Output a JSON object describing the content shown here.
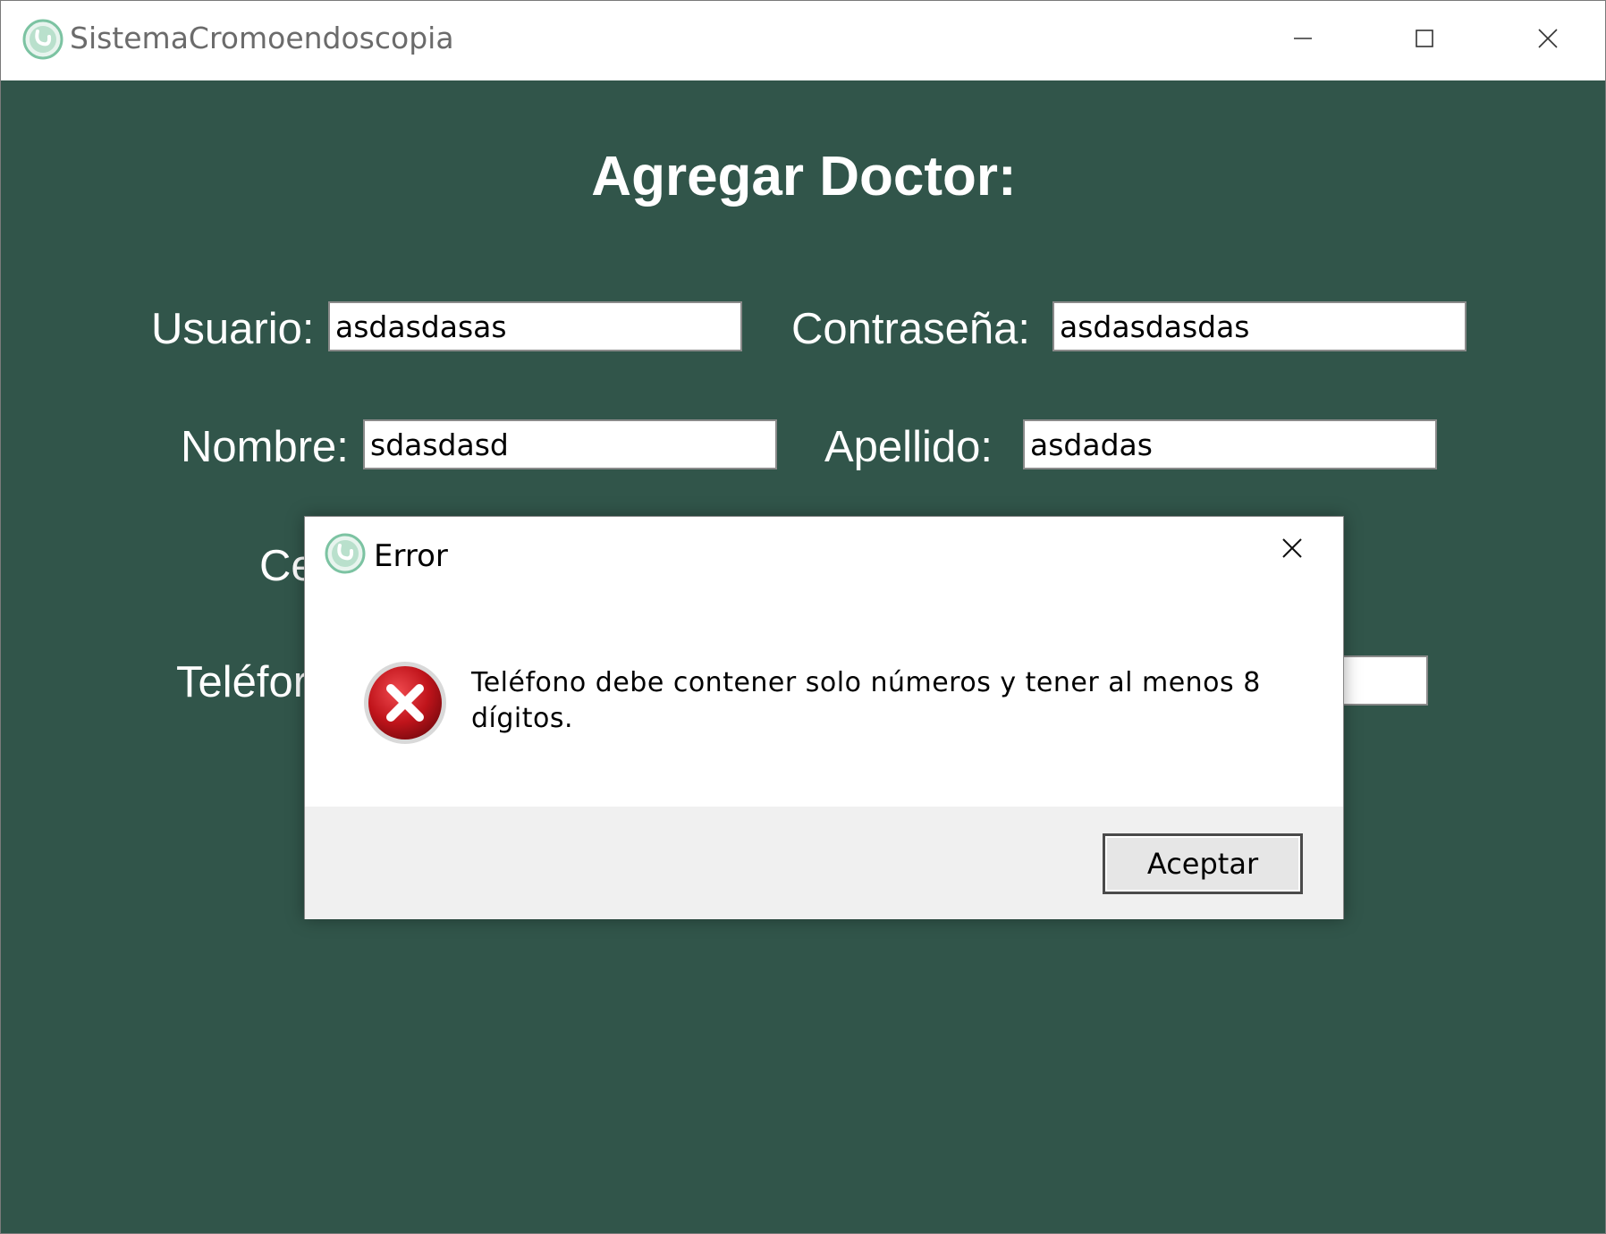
{
  "window": {
    "title": "SistemaCromoendoscopia"
  },
  "form": {
    "heading": "Agregar Doctor:",
    "usuario_label": "Usuario:",
    "usuario_value": "asdasdasas",
    "contrasena_label": "Contraseña:",
    "contrasena_value": "asdasdasdas",
    "nombre_label": "Nombre:",
    "nombre_value": "sdasdasd",
    "apellido_label": "Apellido:",
    "apellido_value": "asdadas",
    "cedula_label_visible": "Ce",
    "telefono_label_visible": "Teléfor"
  },
  "dialog": {
    "title": "Error",
    "message": "Teléfono debe contener solo números y tener al menos 8 dígitos.",
    "ok_label": "Aceptar"
  },
  "colors": {
    "background": "#31554a",
    "error_icon": "#c0141b"
  }
}
